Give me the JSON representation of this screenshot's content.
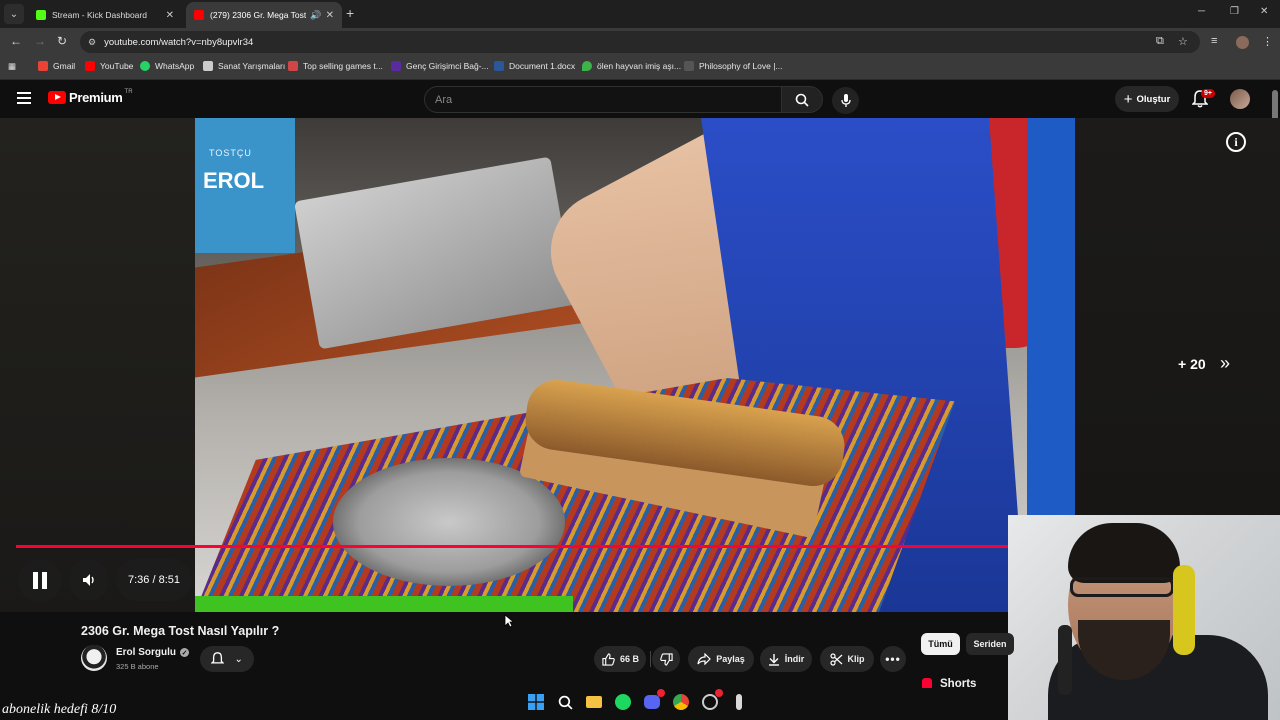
{
  "browser": {
    "tabs": [
      {
        "title": "Stream - Kick Dashboard",
        "active": false,
        "favicon_color": "#53fc18"
      },
      {
        "title": "(279) 2306 Gr. Mega Tost N",
        "active": true,
        "favicon_color": "#ff0000",
        "audio": true
      }
    ],
    "url": "youtube.com/watch?v=nby8upvlr34",
    "bookmarks": [
      {
        "label": "Gmail",
        "icon": "gmail-icon",
        "color": "#ea4335"
      },
      {
        "label": "YouTube",
        "icon": "youtube-icon",
        "color": "#ff0000"
      },
      {
        "label": "WhatsApp",
        "icon": "whatsapp-icon",
        "color": "#25d366"
      },
      {
        "label": "Sanat Yarışmaları",
        "icon": "page-icon",
        "color": "#cccccc"
      },
      {
        "label": "Top selling games t...",
        "icon": "page-icon",
        "color": "#d04545"
      },
      {
        "label": "Genç Girişimci Bağ-...",
        "icon": "m-icon",
        "color": "#5a2aa0"
      },
      {
        "label": "Document 1.docx",
        "icon": "word-icon",
        "color": "#2b579a"
      },
      {
        "label": "ölen hayvan imiş aşı...",
        "icon": "drop-icon",
        "color": "#3db34a"
      },
      {
        "label": "Philosophy of Love |...",
        "icon": "page-icon",
        "color": "#555555"
      }
    ]
  },
  "youtube": {
    "logo_text": "Premium",
    "region": "TR",
    "search_placeholder": "Ara",
    "create_label": "Oluştur",
    "notification_count": "9+"
  },
  "player": {
    "time": "7:36 / 8:51",
    "progress": 0.857,
    "skip_label": "+ 20",
    "video_brand_top": "TOSTÇU",
    "video_brand": "EROL"
  },
  "video": {
    "title": "2306 Gr. Mega Tost Nasıl Yapılır ?",
    "channel": "Erol Sorgulu",
    "subscribers": "325 B abone",
    "likes": "66 B",
    "share_label": "Paylaş",
    "download_label": "İndir",
    "clip_label": "Klip"
  },
  "sidebar": {
    "chips": [
      "Tümü",
      "Seriden"
    ],
    "shorts_label": "Shorts"
  },
  "overlay": {
    "text": "abonelik hedefi 8/10"
  },
  "colors": {
    "accent": "#ff0033",
    "background": "#0f0f0f"
  }
}
